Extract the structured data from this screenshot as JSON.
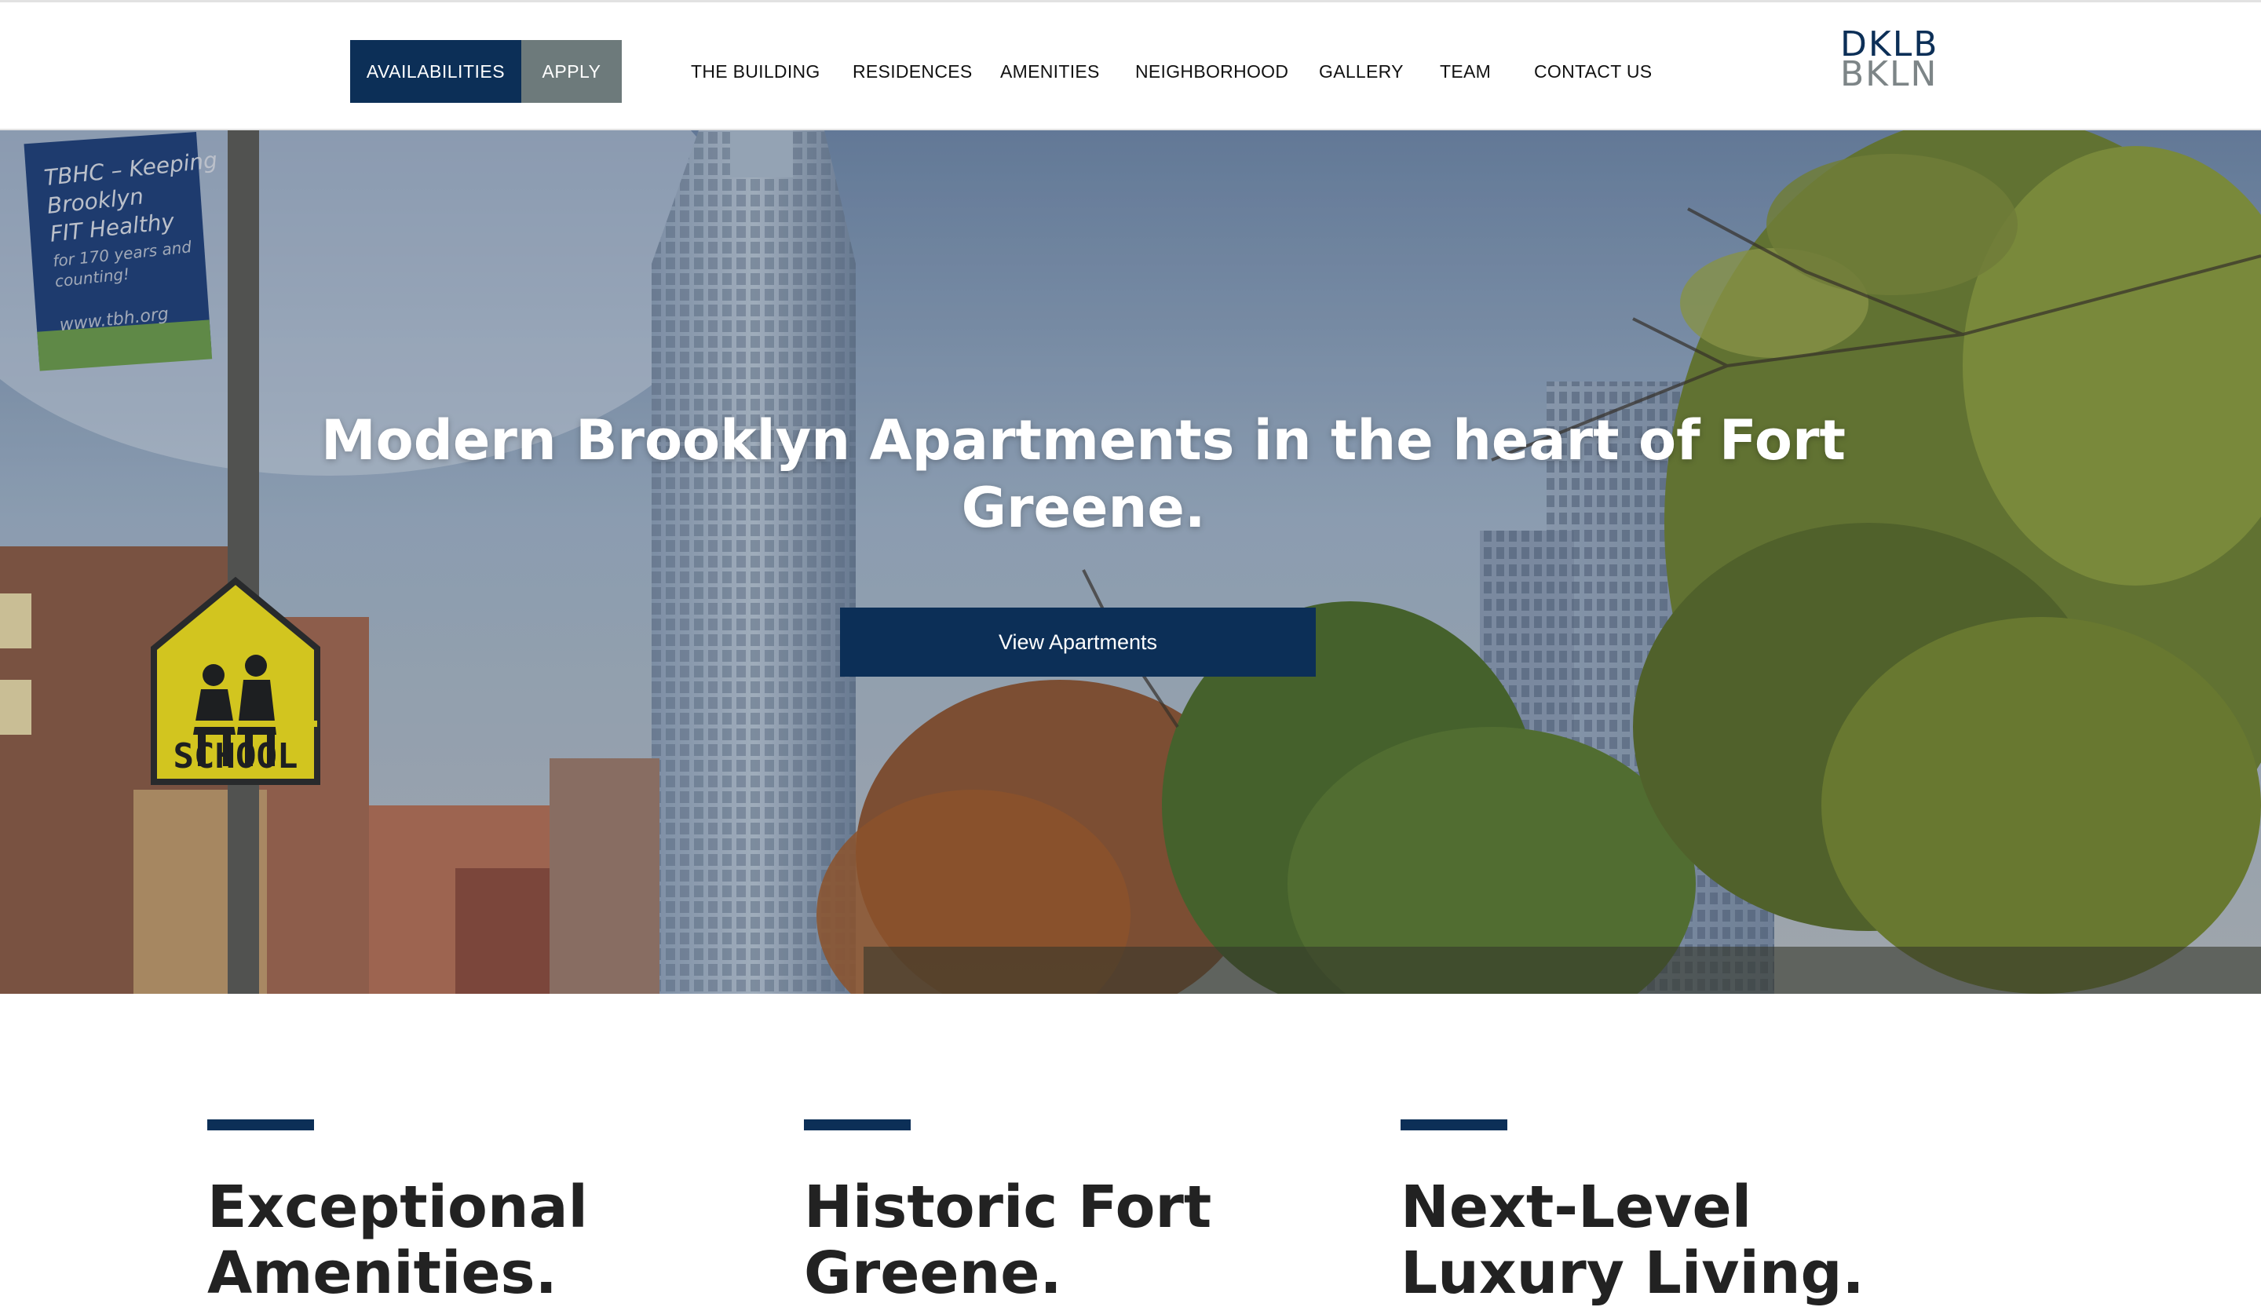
{
  "header": {
    "cta": {
      "availabilities": "AVAILABILITIES",
      "apply": "APPLY"
    },
    "nav": [
      "THE BUILDING",
      "RESIDENCES",
      "AMENITIES",
      "NEIGHBORHOOD",
      "GALLERY",
      "TEAM",
      "CONTACT US"
    ],
    "logo": {
      "line1": "DKLB",
      "line2": "BKLN"
    }
  },
  "hero": {
    "title": "Modern Brooklyn Apartments in the heart of Fort Greene.",
    "button": "View Apartments",
    "banner_text": [
      "TBHC – Keeping",
      "Brooklyn",
      "FIT Healthy",
      "for 170 years and",
      "counting!",
      "www.tbh.org"
    ],
    "sign_text": "SCHOOL"
  },
  "features": [
    {
      "title": "Exceptional Amenities."
    },
    {
      "title": "Historic Fort Greene."
    },
    {
      "title": "Next-Level Luxury Living."
    }
  ],
  "colors": {
    "navy": "#0c2f57",
    "slate": "#6d7a7b",
    "heading": "#222222"
  }
}
